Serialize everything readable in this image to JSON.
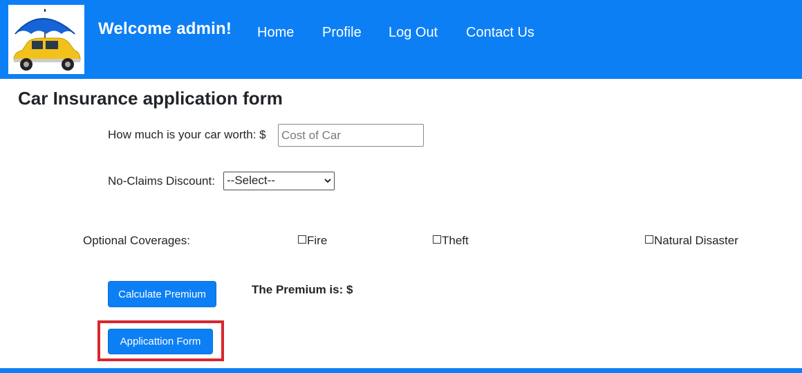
{
  "header": {
    "brand": "Welcome admin!",
    "nav": [
      "Home",
      "Profile",
      "Log Out",
      "Contact Us"
    ]
  },
  "page": {
    "title": "Car Insurance application form"
  },
  "form": {
    "car_worth_label": "How much is your car worth: $",
    "car_worth_placeholder": "Cost of Car",
    "car_worth_value": "",
    "discount_label": "No-Claims Discount:",
    "discount_selected": "--Select--",
    "coverages_label": "Optional Coverages:",
    "coverages": [
      "Fire",
      "Theft",
      "Natural Disaster"
    ],
    "calculate_label": "Calculate Premium",
    "premium_text": "The Premium is: $",
    "application_label": "Applicattion Form"
  },
  "colors": {
    "primary": "#0d7ff5",
    "highlight": "#d9262e"
  },
  "icons": {
    "logo": "car-umbrella-logo",
    "select": "chevron-down-icon"
  }
}
